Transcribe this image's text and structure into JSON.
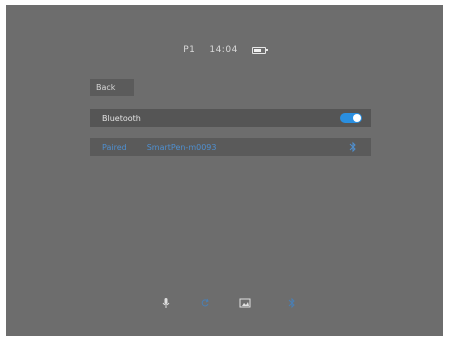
{
  "status": {
    "channel": "P1",
    "time": "14:04",
    "battery_icon": "battery-icon"
  },
  "back_label": "Back",
  "bluetooth": {
    "label": "Bluetooth",
    "enabled": true,
    "accent": "#2a8fe0"
  },
  "paired": {
    "label": "Paired",
    "device": "SmartPen-m0093",
    "icon": "bluetooth-icon",
    "color": "#4f8fcf"
  },
  "dock": {
    "items": [
      "microphone-icon",
      "refresh-icon",
      "gallery-icon",
      "bluetooth-icon"
    ]
  }
}
